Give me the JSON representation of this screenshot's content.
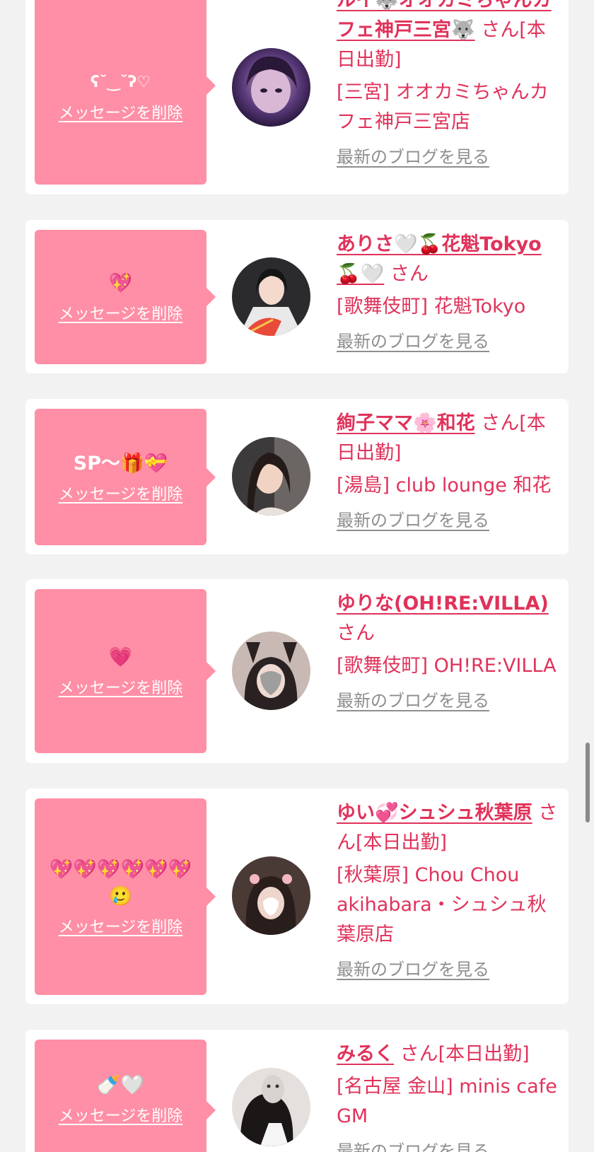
{
  "delete_label": "メッセージを削除",
  "blog_label": "最新のブログを見る",
  "san": "さん",
  "cards": [
    {
      "message": "ʕ˘‿˘ʔ♡",
      "name": "ルイ🐺オオカミちゃんカフェ神戸三宮🐺",
      "suffix": "さん[本日出勤]",
      "shop": "[三宮] オオカミちゃんカフェ神戸三宮店"
    },
    {
      "message": "💖",
      "name": "ありさ🤍🍒花魁Tokyo🍒🤍",
      "suffix": "さん",
      "shop": "[歌舞伎町] 花魁Tokyo"
    },
    {
      "message": "SP〜🎁💝",
      "name": "絢子ママ🌸和花",
      "suffix": "さん[本日出勤]",
      "shop": "[湯島] club lounge 和花"
    },
    {
      "message": "💗",
      "name": "ゆりな(OH!RE:VILLA)",
      "suffix": "さん",
      "shop": "[歌舞伎町] OH!RE:VILLA"
    },
    {
      "message": "💖💖💖💖💖💖🥲",
      "name": "ゆい💞シュシュ秋葉原",
      "suffix": "さん[本日出勤]",
      "shop": "[秋葉原] Chou Chou akihabara・シュシュ秋葉原店"
    },
    {
      "message": "🍼🤍",
      "name": "みるく",
      "suffix": "さん[本日出勤]",
      "shop": "[名古屋 金山] minis cafe GM"
    }
  ]
}
